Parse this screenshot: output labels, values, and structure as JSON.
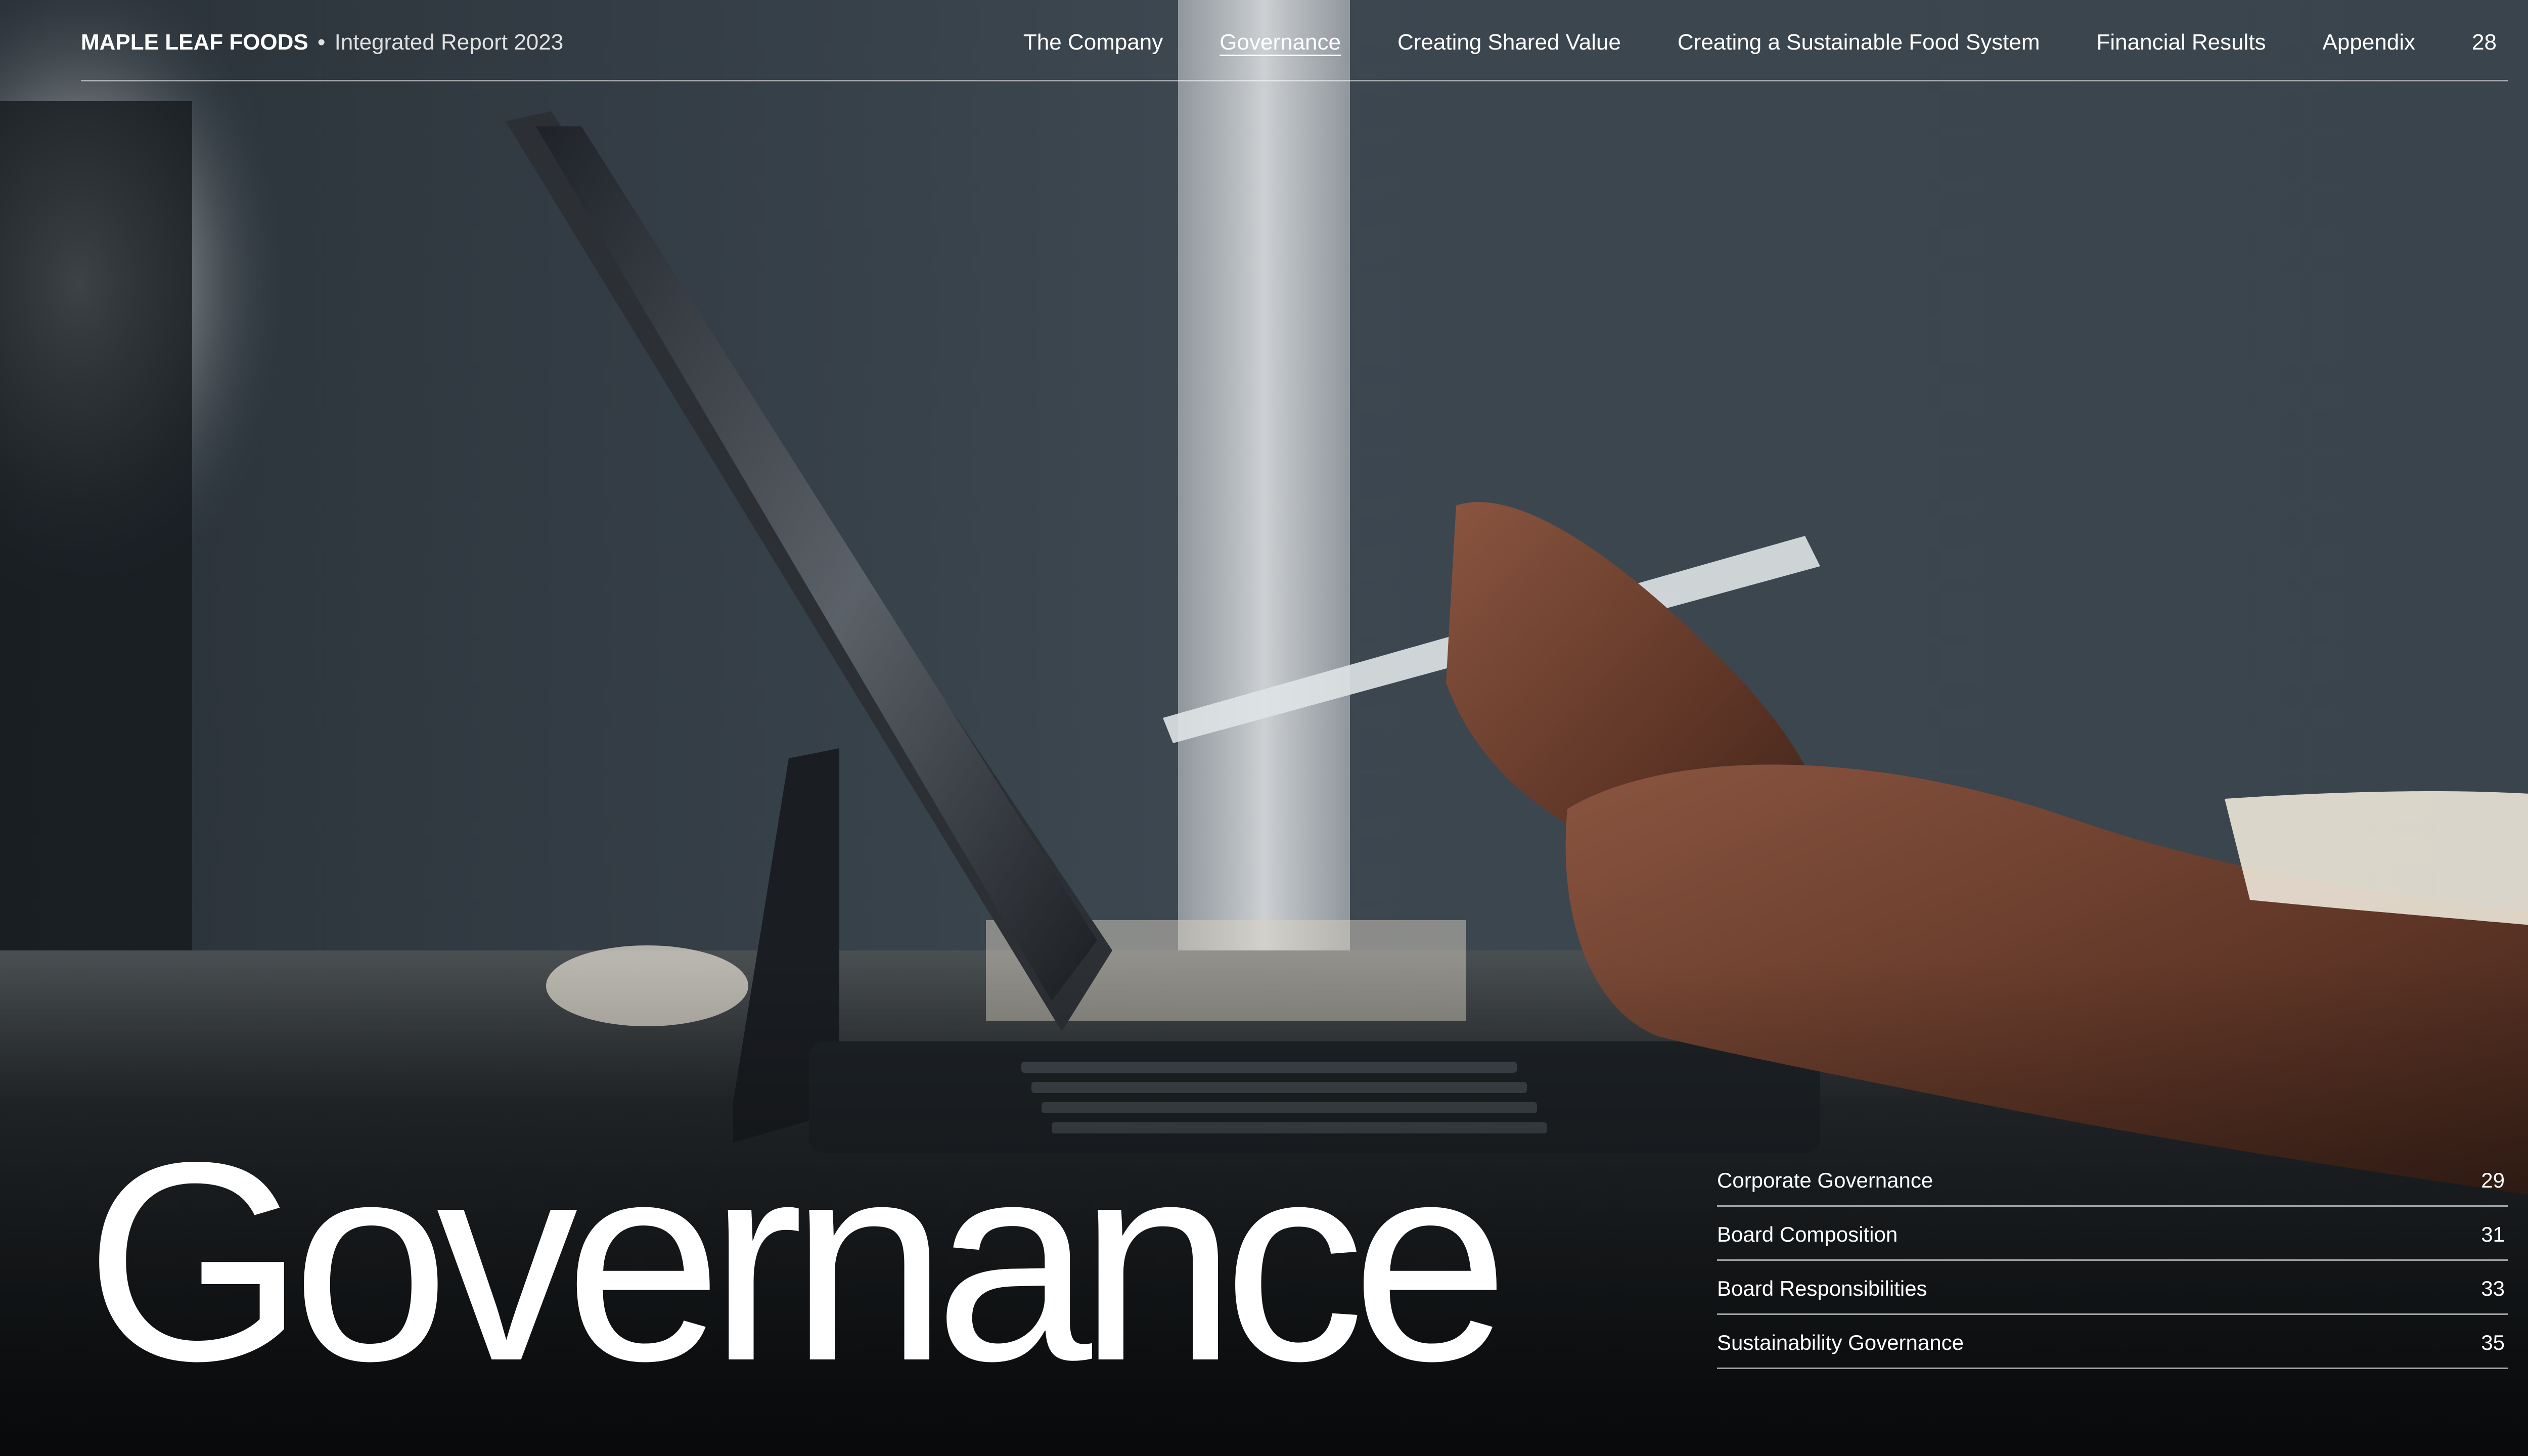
{
  "header": {
    "brand_name": "MAPLE LEAF FOODS",
    "brand_separator": "•",
    "brand_subtitle": "Integrated Report 2023",
    "nav": [
      {
        "label": "The Company",
        "active": false
      },
      {
        "label": "Governance",
        "active": true
      },
      {
        "label": "Creating Shared Value",
        "active": false
      },
      {
        "label": "Creating a Sustainable Food System",
        "active": false
      },
      {
        "label": "Financial Results",
        "active": false
      },
      {
        "label": "Appendix",
        "active": false
      }
    ],
    "page_number": "28"
  },
  "title": "Governance",
  "toc": [
    {
      "label": "Corporate Governance",
      "page": "29"
    },
    {
      "label": "Board Composition",
      "page": "31"
    },
    {
      "label": "Board Responsibilities",
      "page": "33"
    },
    {
      "label": "Sustainability Governance",
      "page": "35"
    }
  ],
  "colors": {
    "text": "#ffffff",
    "background": "#15191d",
    "wall": "#3a454d",
    "skin": "#6b4030"
  }
}
